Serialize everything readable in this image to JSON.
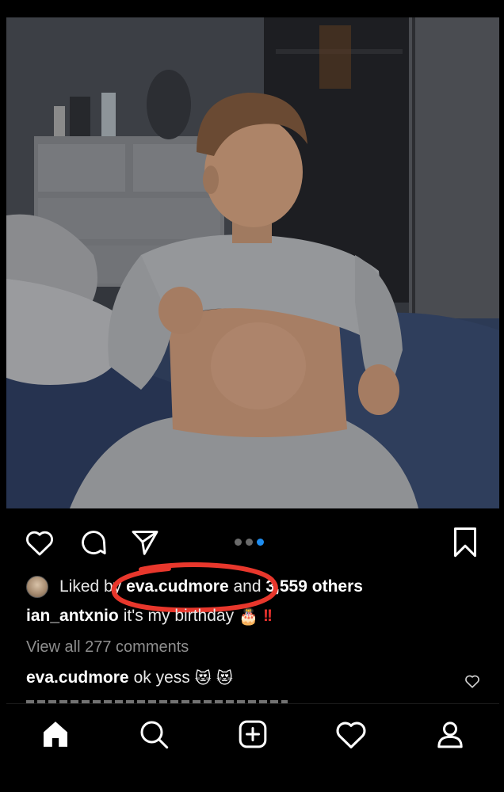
{
  "post": {
    "liked_by_prefix": "Liked by",
    "liked_by_user": "eva.cudmore",
    "liked_by_and": "and",
    "liked_by_others": "3,559 others",
    "caption_user": "ian_antxnio",
    "caption_text": "it's my birthday",
    "caption_emoji": "🎂",
    "caption_bangs": "!!",
    "view_all_comments": "View all 277 comments",
    "comment_user": "eva.cudmore",
    "comment_text": "ok yess",
    "comment_emoji": "😻 😻",
    "carousel": {
      "count": 3,
      "active_index": 3
    }
  },
  "colors": {
    "highlight_circle": "#e8372c",
    "active_dot": "#1e8df0",
    "background": "#000000"
  },
  "icons": {
    "actions": [
      "heart-icon",
      "comment-icon",
      "share-icon",
      "bookmark-icon"
    ],
    "tabbar": [
      "home-icon",
      "search-icon",
      "new-post-icon",
      "activity-icon",
      "profile-icon"
    ]
  }
}
